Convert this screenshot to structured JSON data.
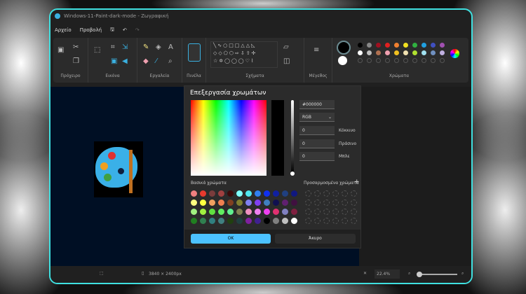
{
  "window": {
    "title": "Windows-11-Paint-dark-mode - Ζωγραφική"
  },
  "menu": {
    "file": "Αρχείο",
    "view": "Προβολή"
  },
  "ribbon": {
    "clipboard": "Πρόχειρο",
    "image": "Εικόνα",
    "tools": "Εργαλεία",
    "brushes": "Πινέλα",
    "shapes": "Σχήματα",
    "size": "Μέγεθος",
    "colors": "Χρώματα"
  },
  "palette": {
    "row1": [
      "#000000",
      "#888888",
      "#a01020",
      "#e02020",
      "#f08030",
      "#f0e020",
      "#30b040",
      "#20a0e0",
      "#4050c0",
      "#a050b0"
    ],
    "row2": [
      "#ffffff",
      "#c0c0c0",
      "#b07050",
      "#f0a0b0",
      "#f0c020",
      "#f0e0b0",
      "#b0e030",
      "#a0e0f0",
      "#7090c0",
      "#c0b0e0"
    ],
    "primary": "#000000",
    "secondary": "#ffffff"
  },
  "dialog": {
    "title": "Επεξεργασία χρωμάτων",
    "hex": "#000000",
    "mode": "RGB",
    "red_label": "Κόκκινο",
    "red": "0",
    "green_label": "Πράσινο",
    "green": "0",
    "blue_label": "Μπλε",
    "blue": "0",
    "basic_label": "Βασικά χρώματα",
    "custom_label": "Προσαρμοσμένα χρώματα",
    "ok": "OK",
    "cancel": "Άκυρο",
    "basic_colors": [
      "#f08080",
      "#e83a2e",
      "#7a3c3c",
      "#a04040",
      "#3a0a0a",
      "#80ffff",
      "#50e8f0",
      "#3080f0",
      "#1030f0",
      "#1020a0",
      "#204080",
      "#101880",
      "#ffff80",
      "#ffff40",
      "#f0a060",
      "#f08050",
      "#804020",
      "#808030",
      "#8080f0",
      "#8040f0",
      "#4080c0",
      "#101050",
      "#602070",
      "#401040",
      "#a0f080",
      "#a0f040",
      "#60e040",
      "#60f060",
      "#60f090",
      "#808050",
      "#f090c0",
      "#f080f0",
      "#f040f0",
      "#e03070",
      "#8080c0",
      "#802040",
      "#208020",
      "#308050",
      "#308080",
      "#408080",
      "#204010",
      "#204040",
      "#8020a0",
      "#402090",
      "#000000",
      "#808080",
      "#c0c0c0",
      "#ffffff"
    ]
  },
  "status": {
    "size": "3840 × 2400px",
    "zoom": "22.4%"
  }
}
